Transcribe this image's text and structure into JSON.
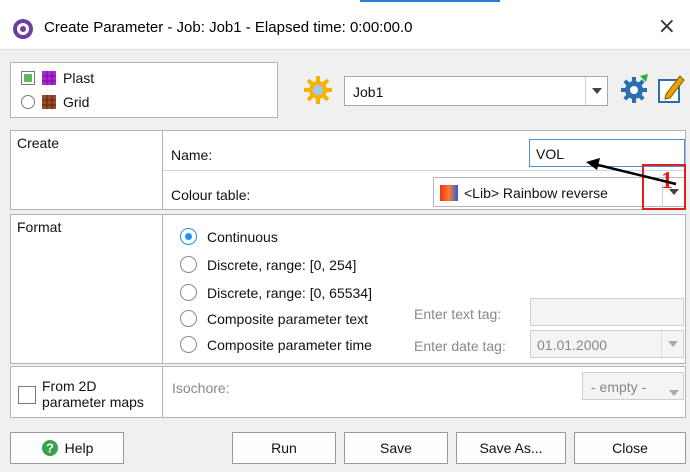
{
  "window": {
    "title": "Create Parameter - Job: Job1 - Elapsed time: 0:00:00.0",
    "close_glyph": "×"
  },
  "visibility": {
    "items": [
      {
        "label": "Plast",
        "control": "checkbox",
        "checked": true,
        "icon": "purple-cube-icon"
      },
      {
        "label": "Grid",
        "control": "radio",
        "checked": false,
        "icon": "brown-cube-icon"
      }
    ]
  },
  "job_selector": {
    "value": "Job1"
  },
  "create_section": {
    "label": "Create",
    "name_label": "Name:",
    "name_value": "VOL",
    "colour_label": "Colour table:",
    "colour_value": "<Lib> Rainbow reverse"
  },
  "annotation": {
    "number": "1",
    "color": "#e02020"
  },
  "format_section": {
    "label": "Format",
    "options": [
      {
        "label": "Continuous",
        "selected": true
      },
      {
        "label": "Discrete, range: [0, 254]",
        "selected": false
      },
      {
        "label": "Discrete, range: [0, 65534]",
        "selected": false
      },
      {
        "label": "Composite parameter text",
        "selected": false
      },
      {
        "label": "Composite parameter time",
        "selected": false
      }
    ],
    "text_tag_label": "Enter text tag:",
    "text_tag_value": "",
    "date_tag_label": "Enter date tag:",
    "date_tag_value": "01.01.2000"
  },
  "maps_section": {
    "checkbox_label_line1": "From 2D",
    "checkbox_label_line2": "parameter maps",
    "isochore_label": "Isochore:",
    "isochore_value": "- empty -"
  },
  "buttons": {
    "help": "Help",
    "run": "Run",
    "save": "Save",
    "save_as": "Save As...",
    "close": "Close"
  }
}
